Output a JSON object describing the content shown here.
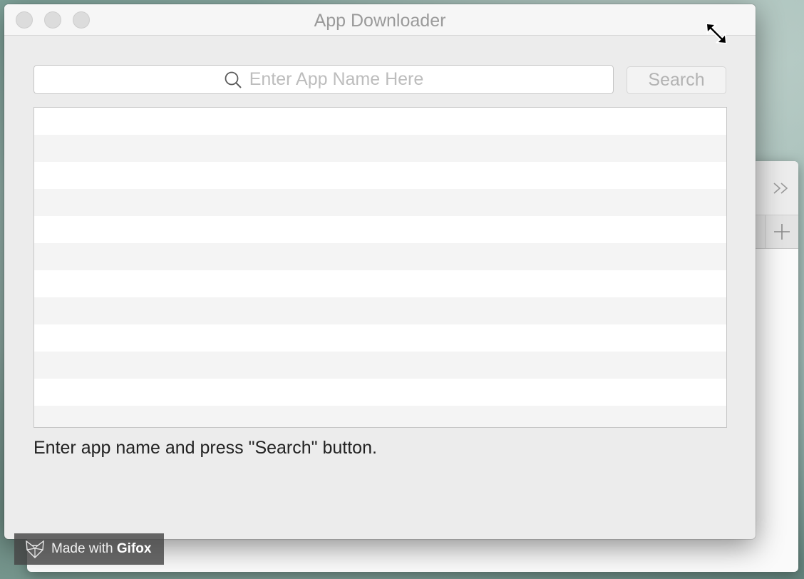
{
  "window": {
    "title": "App Downloader"
  },
  "search": {
    "placeholder": "Enter App Name Here",
    "button_label": "Search"
  },
  "results": {
    "rows": []
  },
  "status": {
    "message": "Enter app name and press \"Search\" button."
  },
  "watermark": {
    "prefix": "Made with",
    "brand": "Gifox"
  }
}
